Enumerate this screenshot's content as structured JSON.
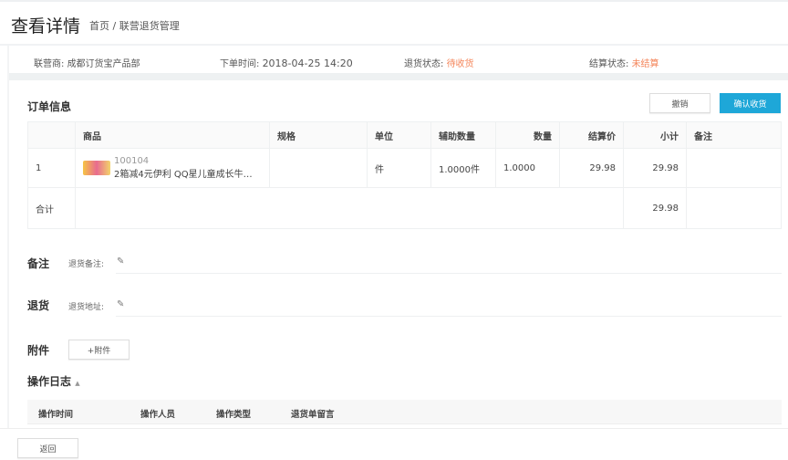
{
  "header": {
    "title": "查看详情",
    "breadcrumb": "首页 / 联营退货管理"
  },
  "info": {
    "vendor_label": "联营商:",
    "vendor": "成都订货宝产品部",
    "time_label": "下单时间:",
    "time": "2018-04-25 14:20",
    "return_status_label": "退货状态:",
    "return_status": "待收货",
    "settle_status_label": "结算状态:",
    "settle_status": "未结算"
  },
  "order": {
    "title": "订单信息",
    "cancel": "撤销",
    "confirm": "确认收货",
    "columns": [
      "",
      "商品",
      "规格",
      "单位",
      "辅助数量",
      "数量",
      "结算价",
      "小计",
      "备注"
    ],
    "rows": [
      {
        "index": "1",
        "code": "100104",
        "name": "2箱减4元伊利 QQ星儿童成长牛…",
        "spec": "",
        "unit": "件",
        "aux_qty": "1.0000件",
        "qty": "1.0000",
        "price": "29.98",
        "subtotal": "29.98",
        "remark": ""
      }
    ],
    "total_label": "合计",
    "total": "29.98"
  },
  "remark": {
    "title": "备注",
    "label": "退货备注:"
  },
  "return": {
    "title": "退货",
    "label": "退货地址:"
  },
  "attach": {
    "title": "附件",
    "button": "+附件"
  },
  "log": {
    "title": "操作日志",
    "toggle": "▲",
    "columns": [
      "操作时间",
      "操作人员",
      "操作类型",
      "退货单留言"
    ]
  },
  "footer": {
    "back": "返回"
  }
}
